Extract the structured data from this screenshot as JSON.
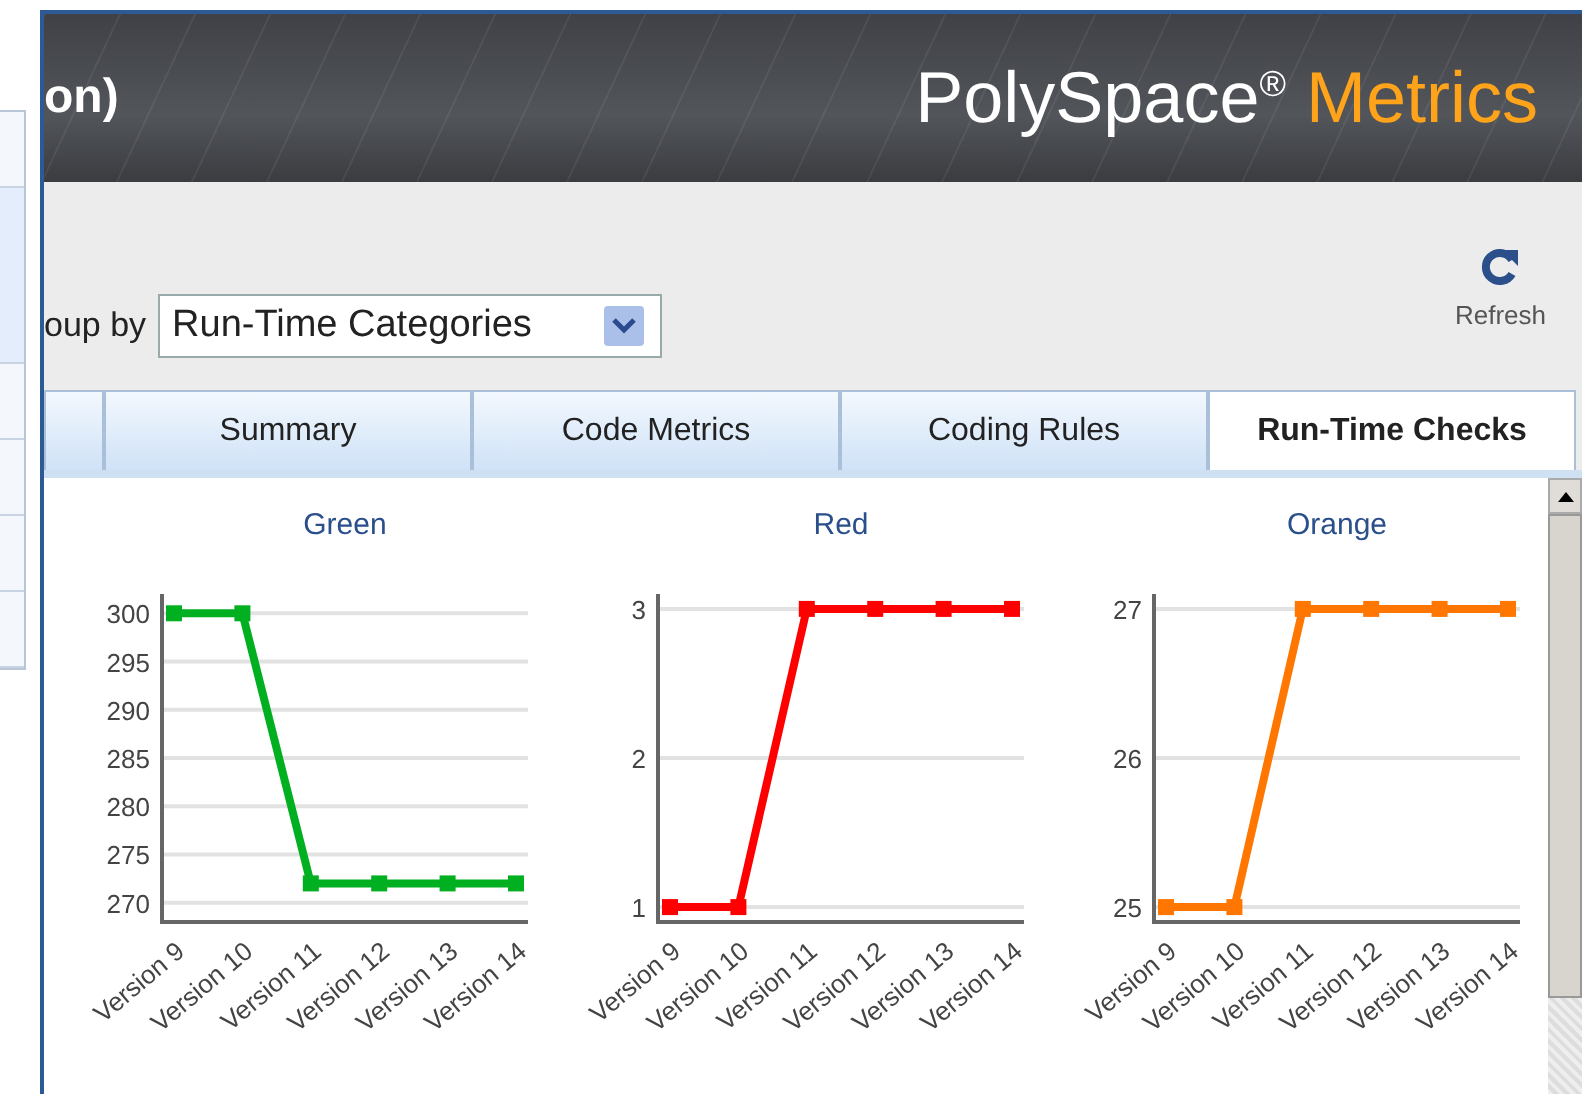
{
  "header": {
    "title": "on)",
    "logo": {
      "name": "PolySpace$^{®}$",
      "product": "Metrics"
    }
  },
  "toolbar": {
    "group_by_label": "oup by",
    "group_by_value": "Run-Time Categories",
    "refresh_label": "Refresh"
  },
  "tabs": [
    {
      "selected": false
    },
    {
      "label": "Summary",
      "selected": false
    },
    {
      "label": "Code Metrics",
      "selected": false
    },
    {
      "label": "Coding Rules",
      "selected": false
    },
    {
      "label": "Run-Time Checks",
      "selected": true
    }
  ],
  "charts": [
    {
      "chart_data": {
        "type": "line",
        "title": "Green",
        "categories": [
          "Version 9",
          "Version 10",
          "Version 11",
          "Version 12",
          "Version 13",
          "Version 14"
        ],
        "series": [
          {
            "color": "#00b020",
            "marker": "square",
            "values": [
              300,
              300,
              272,
              272,
              272,
              272
            ]
          }
        ],
        "ylim": [
          268,
          302
        ],
        "yticks": [
          270,
          275,
          280,
          285,
          290,
          295,
          300
        ],
        "grid": true
      }
    },
    {
      "chart_data": {
        "type": "line",
        "title": "Red",
        "categories": [
          "Version 9",
          "Version 10",
          "Version 11",
          "Version 12",
          "Version 13",
          "Version 14"
        ],
        "series": [
          {
            "color": "#ff0000",
            "marker": "square",
            "values": [
              1,
              1,
              3,
              3,
              3,
              3
            ]
          }
        ],
        "ylim": [
          0.9,
          3.1
        ],
        "yticks": [
          1,
          2,
          3
        ],
        "grid": true
      }
    },
    {
      "chart_data": {
        "type": "line",
        "title": "Orange",
        "categories": [
          "Version 9",
          "Version 10",
          "Version 11",
          "Version 12",
          "Version 13",
          "Version 14"
        ],
        "series": [
          {
            "color": "#ff7700",
            "marker": "square",
            "values": [
              25,
              25,
              27,
              27,
              27,
              27
            ]
          }
        ],
        "ylim": [
          24.9,
          27.1
        ],
        "yticks": [
          25,
          26,
          27
        ],
        "grid": true
      }
    }
  ]
}
